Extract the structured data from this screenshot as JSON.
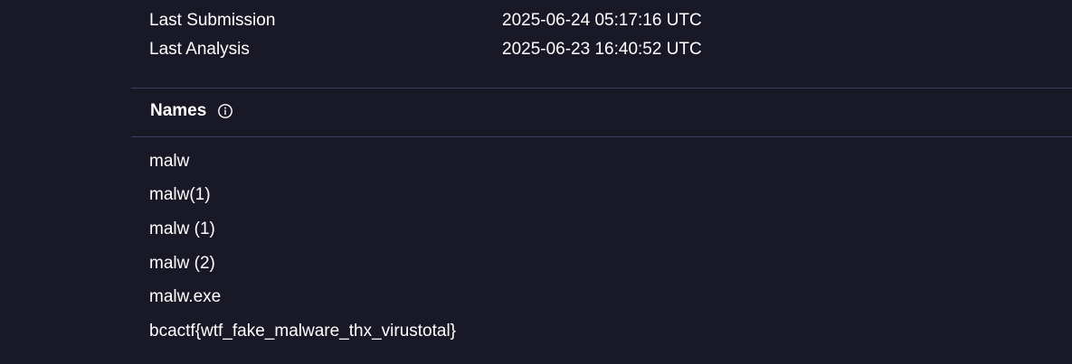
{
  "history": [
    {
      "label": "Last Submission",
      "value": "2025-06-24 05:17:16 UTC"
    },
    {
      "label": "Last Analysis",
      "value": "2025-06-23 16:40:52 UTC"
    }
  ],
  "names_section": {
    "title": "Names",
    "info_icon": "info-circle-icon",
    "items": [
      "malw",
      "malw(1)",
      "malw (1)",
      "malw (2)",
      "malw.exe",
      "bcactf{wtf_fake_malware_thx_virustotal}"
    ]
  },
  "colors": {
    "background": "#181826",
    "divider": "#3b3d5e",
    "text": "#ffffff"
  }
}
